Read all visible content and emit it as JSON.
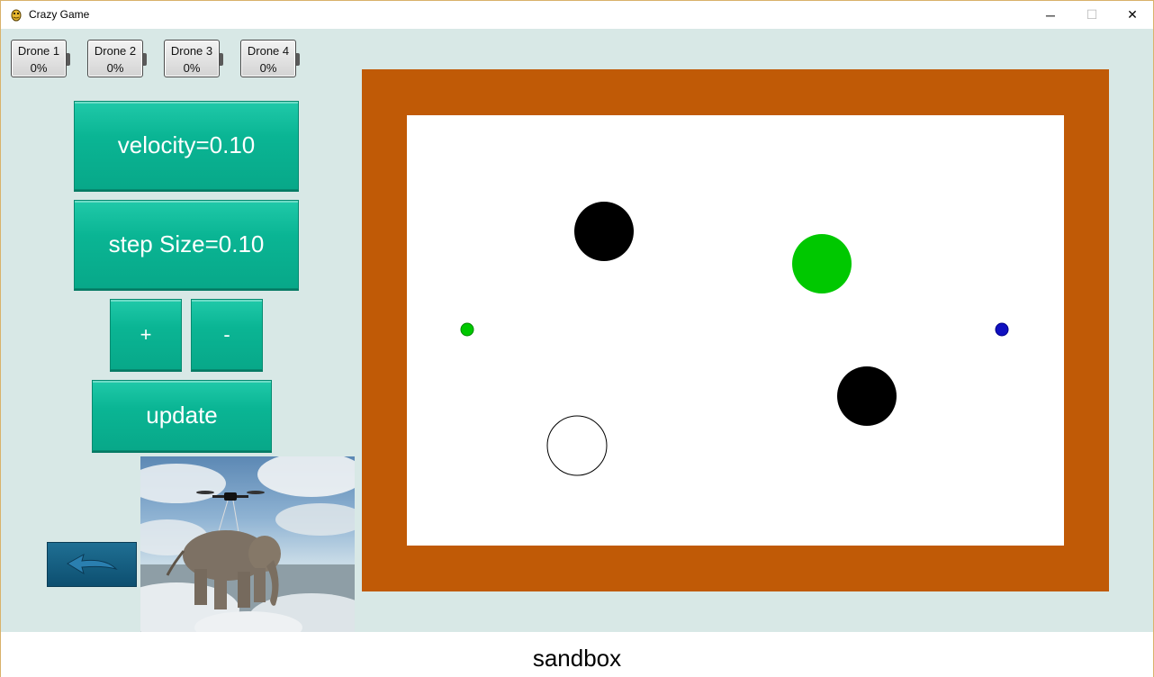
{
  "window": {
    "title": "Crazy Game",
    "controls": {
      "minimize": "─",
      "maximize": "☐",
      "close": "✕"
    }
  },
  "drones": [
    {
      "name": "Drone 1",
      "percent": "0%"
    },
    {
      "name": "Drone 2",
      "percent": "0%"
    },
    {
      "name": "Drone 3",
      "percent": "0%"
    },
    {
      "name": "Drone 4",
      "percent": "0%"
    }
  ],
  "controls": {
    "velocity_label": "velocity=0.10",
    "step_size_label": "step Size=0.10",
    "plus_label": "+",
    "minus_label": "-",
    "update_label": "update"
  },
  "icons": {
    "app": "pygame-snake-icon",
    "back": "back-arrow-icon",
    "image": "drone-lifting-elephant-image"
  },
  "arena": {
    "border_color": "#c05a06",
    "field_color": "#ffffff",
    "objects": [
      {
        "kind": "obstacle",
        "color": "#000000"
      },
      {
        "kind": "obstacle",
        "color": "#000000"
      },
      {
        "kind": "target",
        "color": "#00c800"
      },
      {
        "kind": "start-hole",
        "color": "#ffffff"
      },
      {
        "kind": "drone-marker",
        "color": "#00c800"
      },
      {
        "kind": "drone-marker",
        "color": "#1010c0"
      }
    ]
  },
  "colors": {
    "accent": "#0ab594",
    "background": "#d8e8e6",
    "back_button": "#0d4f70"
  },
  "status": {
    "mode": "sandbox"
  }
}
